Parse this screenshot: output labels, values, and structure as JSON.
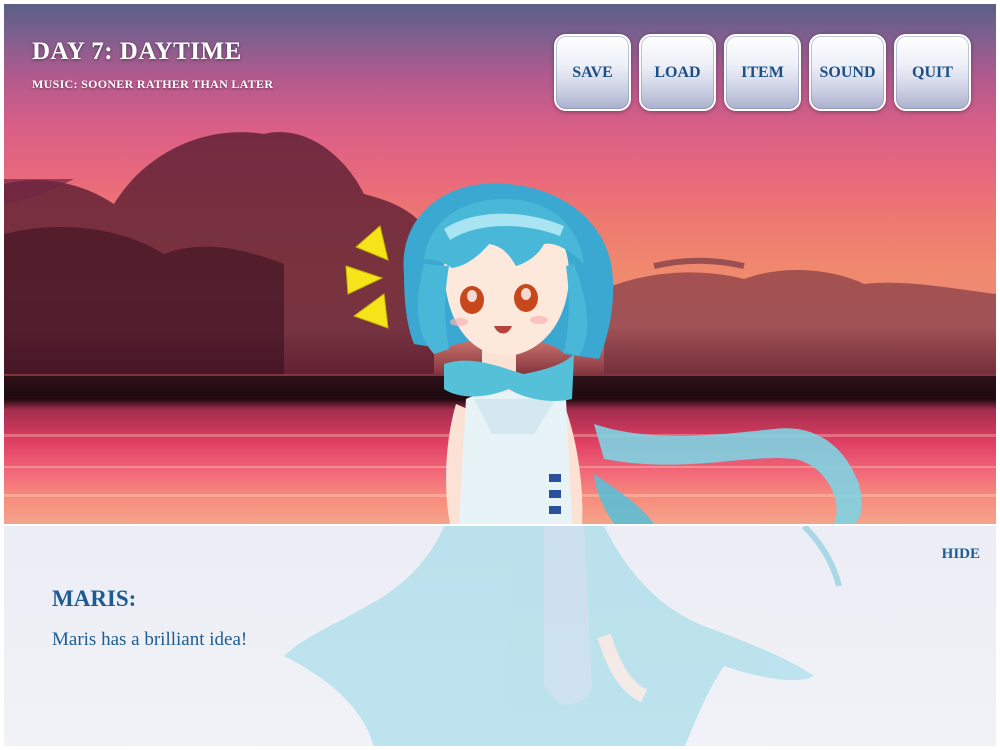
{
  "hud": {
    "title": "DAY 7: DAYTIME",
    "music": "MUSIC: SOONER RATHER THAN LATER"
  },
  "menu": {
    "save": "SAVE",
    "load": "LOAD",
    "item": "ITEM",
    "sound": "SOUND",
    "quit": "QUIT"
  },
  "dialogue": {
    "hide": "HIDE",
    "speaker": "MARIS:",
    "text": "Maris has a brilliant idea!"
  },
  "scene": {
    "setting": "sunset beach",
    "character_hair": "#49b8d8",
    "exclaim_color": "#f5e41a"
  }
}
